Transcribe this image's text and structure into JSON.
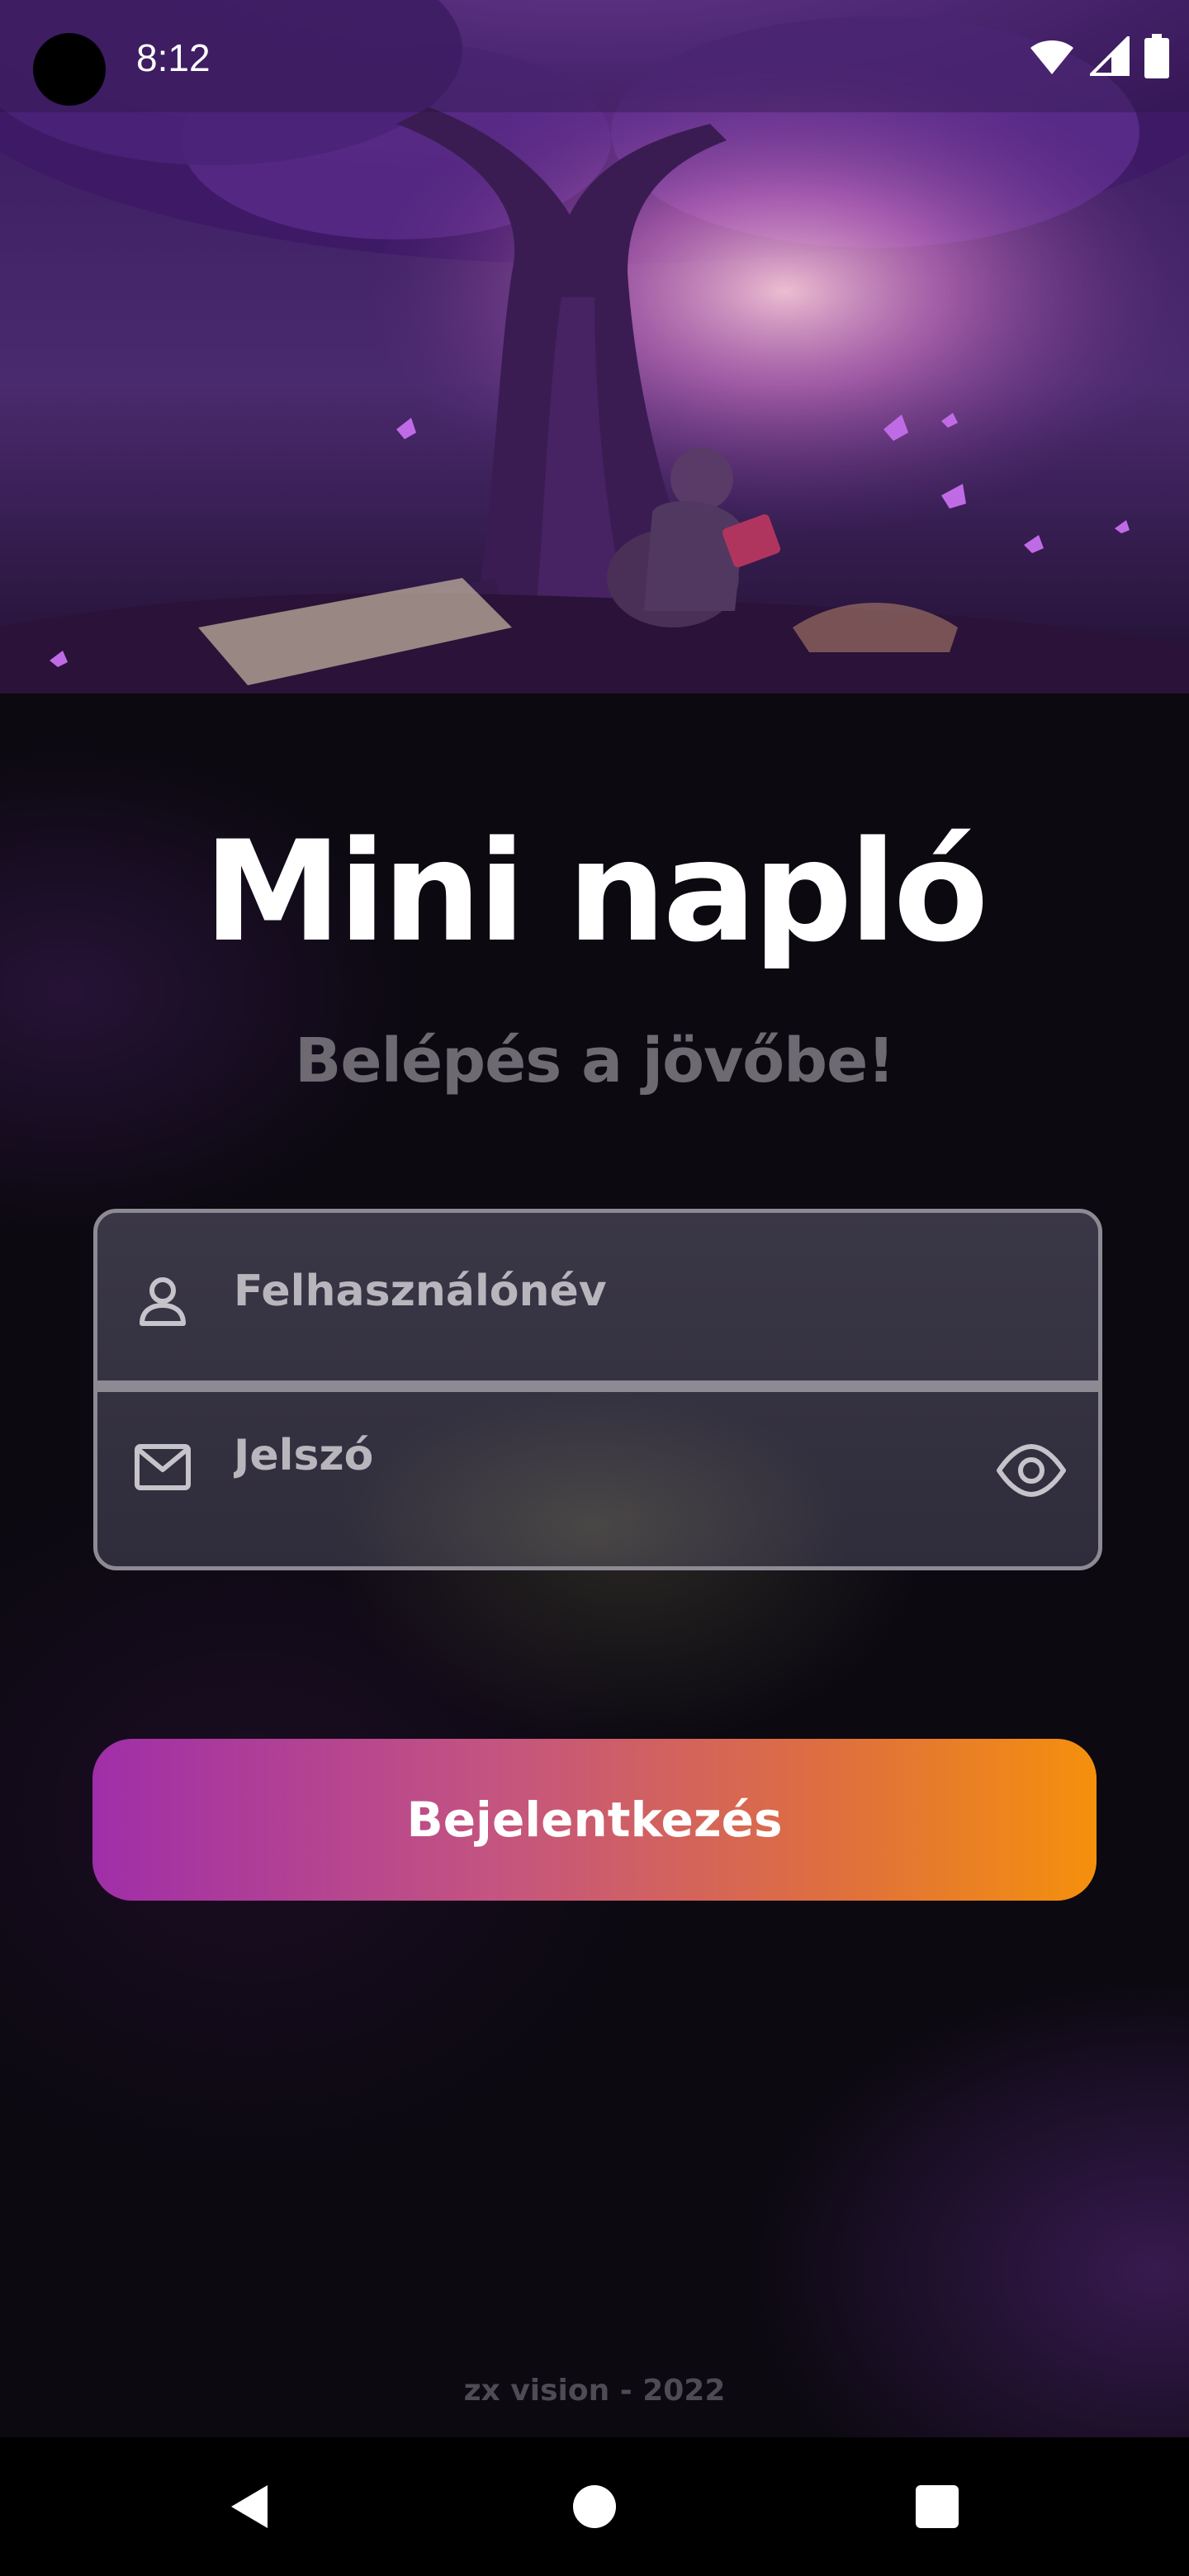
{
  "status_bar": {
    "time": "8:12",
    "icons": [
      "wifi-icon",
      "signal-icon",
      "battery-icon"
    ]
  },
  "hero": {
    "description_icon": "hero-illustration"
  },
  "title": "Mini napló",
  "subtitle": "Belépés a jövőbe!",
  "form": {
    "username": {
      "placeholder": "Felhasználónév",
      "value": "",
      "icon": "person-icon"
    },
    "password": {
      "placeholder": "Jelszó",
      "value": "",
      "icon": "mail-icon",
      "toggle_icon": "eye-icon"
    }
  },
  "login_button": {
    "label": "Bejelentkezés"
  },
  "footer": {
    "text": "zx vision - 2022"
  },
  "nav_bar": {
    "buttons": [
      "back-icon",
      "home-icon",
      "recents-icon"
    ]
  },
  "colors": {
    "background": "#0c0911",
    "title": "#ffffff",
    "subtitle": "#6d6a72",
    "field_border": "#8d8a93",
    "button_start": "#a02ea8",
    "button_end": "#f5900c",
    "footer": "#4e4b54"
  }
}
